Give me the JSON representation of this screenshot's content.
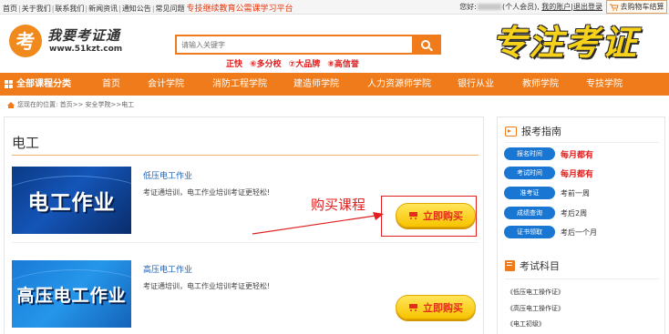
{
  "topbar": {
    "links": [
      "首页",
      "关于我们",
      "联系我们",
      "新闻资讯",
      "通知公告",
      "常见问题"
    ],
    "promo": "专技继续教育公需课学习平台",
    "greeting": "您好:",
    "member_suffix": "(个人会员),",
    "account_link": "我的账户",
    "logout_link": "退出登录",
    "cart_label": "去购物车结算"
  },
  "header": {
    "logo_badge": "考",
    "logo_name": "我要考证通",
    "logo_url": "www.51kzt.com",
    "search_placeholder": "请输入关键字",
    "features": [
      "正快",
      "⑥多分校",
      "⑦大品牌",
      "⑧高信誉"
    ],
    "slogan": "专注考证"
  },
  "nav": {
    "all_courses": "全部课程分类",
    "items": [
      "首页",
      "会计学院",
      "消防工程学院",
      "建造师学院",
      "人力资源师学院",
      "银行从业",
      "教师学院",
      "专技学院"
    ]
  },
  "breadcrumb": {
    "text": "您现在的位置: 首页>>  安全学院>>电工"
  },
  "main": {
    "title": "电工",
    "courses": [
      {
        "thumb_text": "电工作业",
        "name": "低压电工作业",
        "desc": "考证通培训，电工作业培训考证更轻松!",
        "buy_label": "立即购买"
      },
      {
        "thumb_text": "高压电工作业",
        "name": "高压电工作业",
        "desc": "考证通培训，电工作业培训考证更轻松!",
        "buy_label": "立即购买"
      }
    ],
    "annotation": "购买课程"
  },
  "sidebar": {
    "guide_title": "报考指南",
    "guide": [
      {
        "label": "报名时间",
        "value": "每月都有",
        "highlight": true
      },
      {
        "label": "考试时间",
        "value": "每月都有",
        "highlight": true
      },
      {
        "label": "准考证",
        "value": "考前一周",
        "highlight": false
      },
      {
        "label": "成绩查询",
        "value": "考后2周",
        "highlight": false
      },
      {
        "label": "证书领取",
        "value": "考后一个月",
        "highlight": false
      }
    ],
    "subjects_title": "考试科目",
    "subjects": [
      "《低压电工操作证》",
      "《高压电工操作证》",
      "《电工初级》"
    ]
  },
  "colors": {
    "brand_orange": "#f07b1a",
    "pill_blue": "#1976d2",
    "highlight_red": "#e21d1d"
  }
}
